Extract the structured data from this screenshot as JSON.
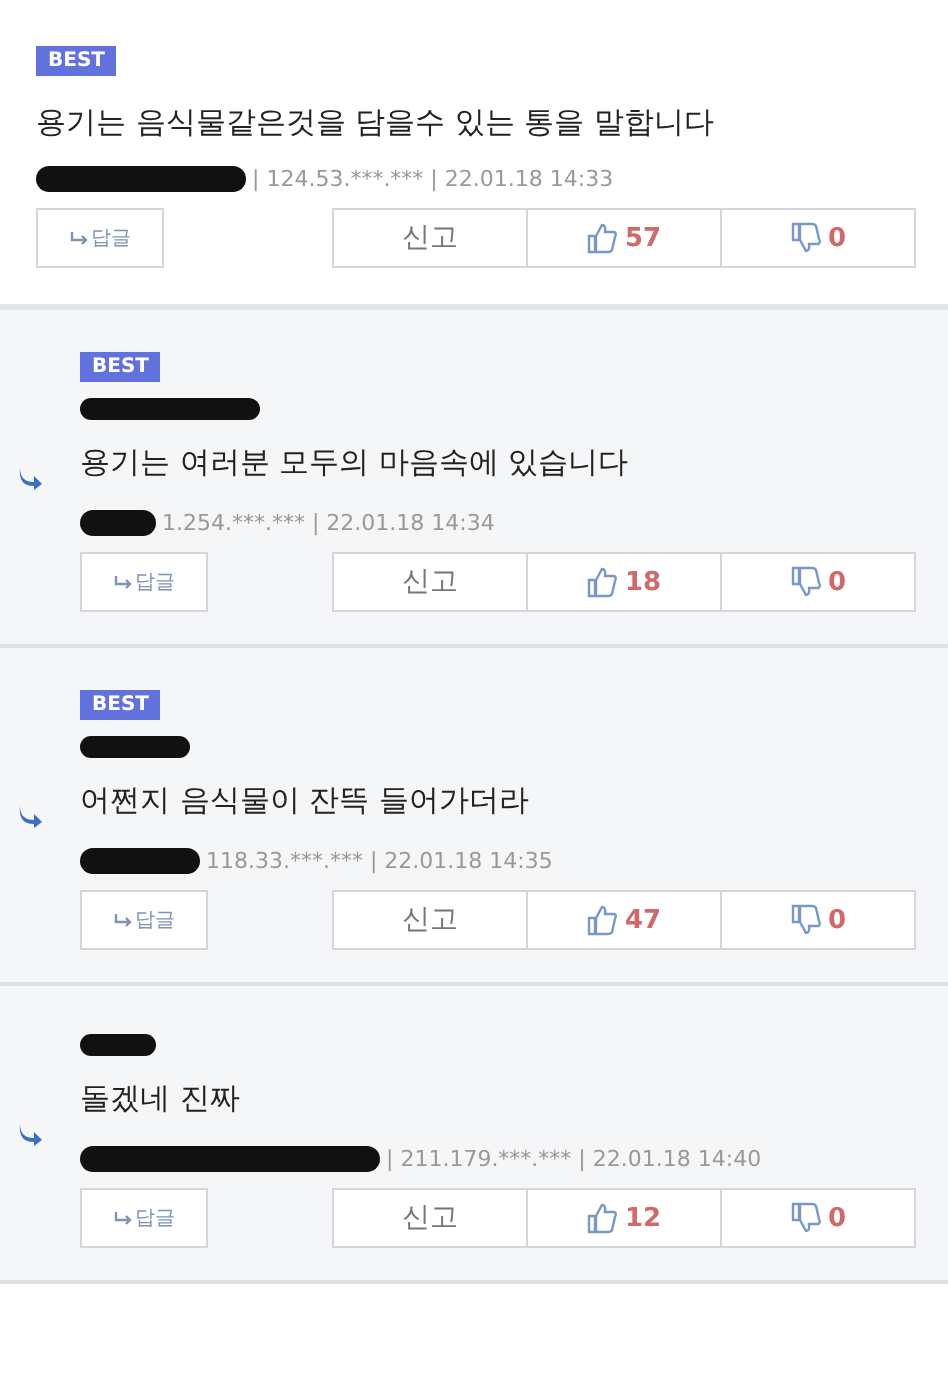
{
  "comments": [
    {
      "kind": "comment",
      "best": true,
      "badge": "BEST",
      "text": "용기는 음식물같은것을 담을수 있는 통을 말합니다",
      "meta": "| 124.53.***.*** | 22.01.18 14:33",
      "reply_label": "답글",
      "report_label": "신고",
      "likes": "57",
      "dislikes": "0"
    },
    {
      "kind": "reply",
      "best": true,
      "badge": "BEST",
      "text": "용기는 여러분 모두의 마음속에 있습니다",
      "meta": "1.254.***.*** | 22.01.18 14:34",
      "reply_label": "답글",
      "report_label": "신고",
      "likes": "18",
      "dislikes": "0"
    },
    {
      "kind": "reply",
      "best": true,
      "badge": "BEST",
      "text": "어쩐지 음식물이 잔뜩 들어가더라",
      "meta": "118.33.***.*** | 22.01.18 14:35",
      "reply_label": "답글",
      "report_label": "신고",
      "likes": "47",
      "dislikes": "0"
    },
    {
      "kind": "reply",
      "best": false,
      "text": "돌겠네 진짜",
      "meta": "| 211.179.***.*** | 22.01.18 14:40",
      "reply_label": "답글",
      "report_label": "신고",
      "likes": "12",
      "dislikes": "0"
    }
  ]
}
